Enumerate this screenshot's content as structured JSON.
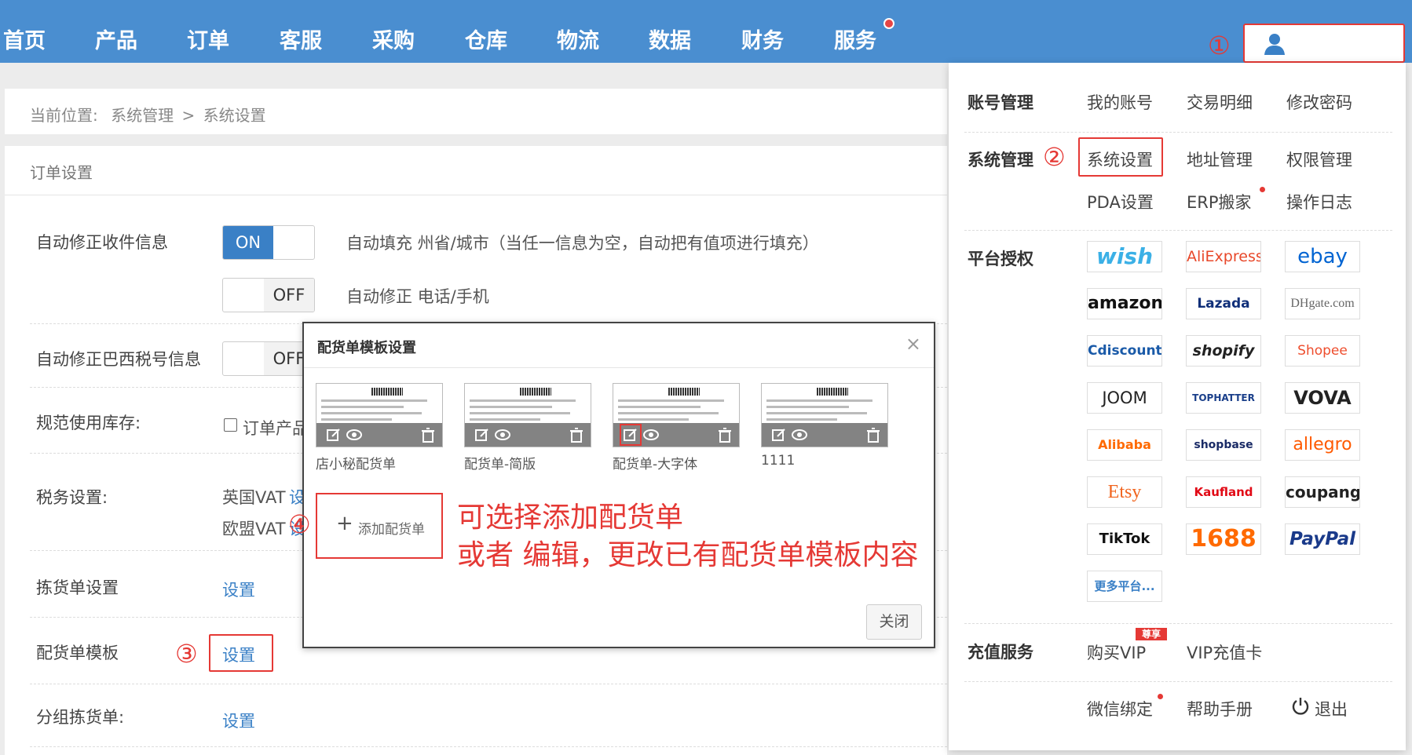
{
  "nav": {
    "items": [
      "首页",
      "产品",
      "订单",
      "客服",
      "采购",
      "仓库",
      "物流",
      "数据",
      "财务",
      "服务"
    ],
    "has_notification": true
  },
  "annotations": {
    "a1": "①",
    "a2": "②",
    "a3": "③",
    "a4": "④"
  },
  "breadcrumb": {
    "prefix": "当前位置:",
    "level1": "系统管理",
    "separator": ">",
    "level2": "系统设置"
  },
  "order_settings": {
    "title": "订单设置",
    "auto_fix_receiver": {
      "label": "自动修正收件信息",
      "toggle1": "ON",
      "desc1": "自动填充 州省/城市（当任一信息为空，自动把有值项进行填充）",
      "toggle2": "OFF",
      "desc2": "自动修正 电话/手机"
    },
    "brazil_tax": {
      "label": "自动修正巴西税号信息",
      "toggle": "OFF"
    },
    "inventory": {
      "label": "规范使用库存:",
      "checkbox_label": "订单产品"
    },
    "tax": {
      "label": "税务设置:",
      "uk": "英国VAT",
      "uk_link": "设",
      "eu": "欧盟VAT",
      "eu_link": "设"
    },
    "picking": {
      "label": "拣货单设置",
      "link": "设置"
    },
    "packing_template": {
      "label": "配货单模板",
      "link": "设置"
    },
    "group_picking": {
      "label": "分组拣货单:",
      "link": "设置"
    }
  },
  "modal": {
    "title": "配货单模板设置",
    "close_x": "×",
    "templates": [
      {
        "name": "店小秘配货单"
      },
      {
        "name": "配货单-简版"
      },
      {
        "name": "配货单-大字体"
      },
      {
        "name": "1111"
      }
    ],
    "add_plus": "+",
    "add_label": "添加配货单",
    "note_line1": "可选择添加配货单",
    "note_line2": "或者 编辑，更改已有配货单模板内容",
    "close_button": "关闭"
  },
  "dropdown": {
    "account": {
      "title": "账号管理",
      "links": [
        "我的账号",
        "交易明细",
        "修改密码"
      ]
    },
    "system": {
      "title": "系统管理",
      "links": [
        "系统设置",
        "地址管理",
        "权限管理",
        "PDA设置",
        "ERP搬家",
        "操作日志"
      ]
    },
    "platforms": {
      "title": "平台授权",
      "logos": [
        "wish",
        "AliExpress",
        "ebay",
        "amazon",
        "Lazada",
        "DHgate.com",
        "Cdiscount",
        "shopify",
        "Shopee",
        "JOOM",
        "TOPHATTER",
        "VOVA",
        "Alibaba",
        "shopbase",
        "allegro",
        "Etsy",
        "Kaufland",
        "coupang",
        "TikTok",
        "1688",
        "PayPal"
      ],
      "more": "更多平台..."
    },
    "recharge": {
      "title": "充值服务",
      "buy_vip": "购买VIP",
      "vip_badge": "尊享",
      "vip_card": "VIP充值卡"
    },
    "bottom": {
      "wechat": "微信绑定",
      "help": "帮助手册",
      "logout": "退出"
    }
  },
  "colors": {
    "nav_bg": "#4a8ed0",
    "accent": "#3a80c6",
    "annotation": "#e53935"
  }
}
